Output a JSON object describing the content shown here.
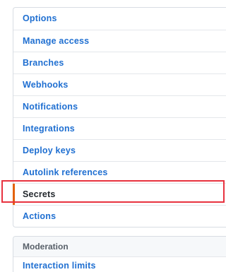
{
  "settings_menu": {
    "items": [
      {
        "label": "Options"
      },
      {
        "label": "Manage access"
      },
      {
        "label": "Branches"
      },
      {
        "label": "Webhooks"
      },
      {
        "label": "Notifications"
      },
      {
        "label": "Integrations"
      },
      {
        "label": "Deploy keys"
      },
      {
        "label": "Autolink references"
      },
      {
        "label": "Secrets"
      },
      {
        "label": "Actions"
      }
    ],
    "selected": "Secrets"
  },
  "moderation_menu": {
    "header": "Moderation",
    "items": [
      {
        "label": "Interaction limits"
      }
    ]
  },
  "colors": {
    "link": "#1f6fd1",
    "selected_indicator": "#e36209",
    "highlight_outline": "#e8323f"
  }
}
